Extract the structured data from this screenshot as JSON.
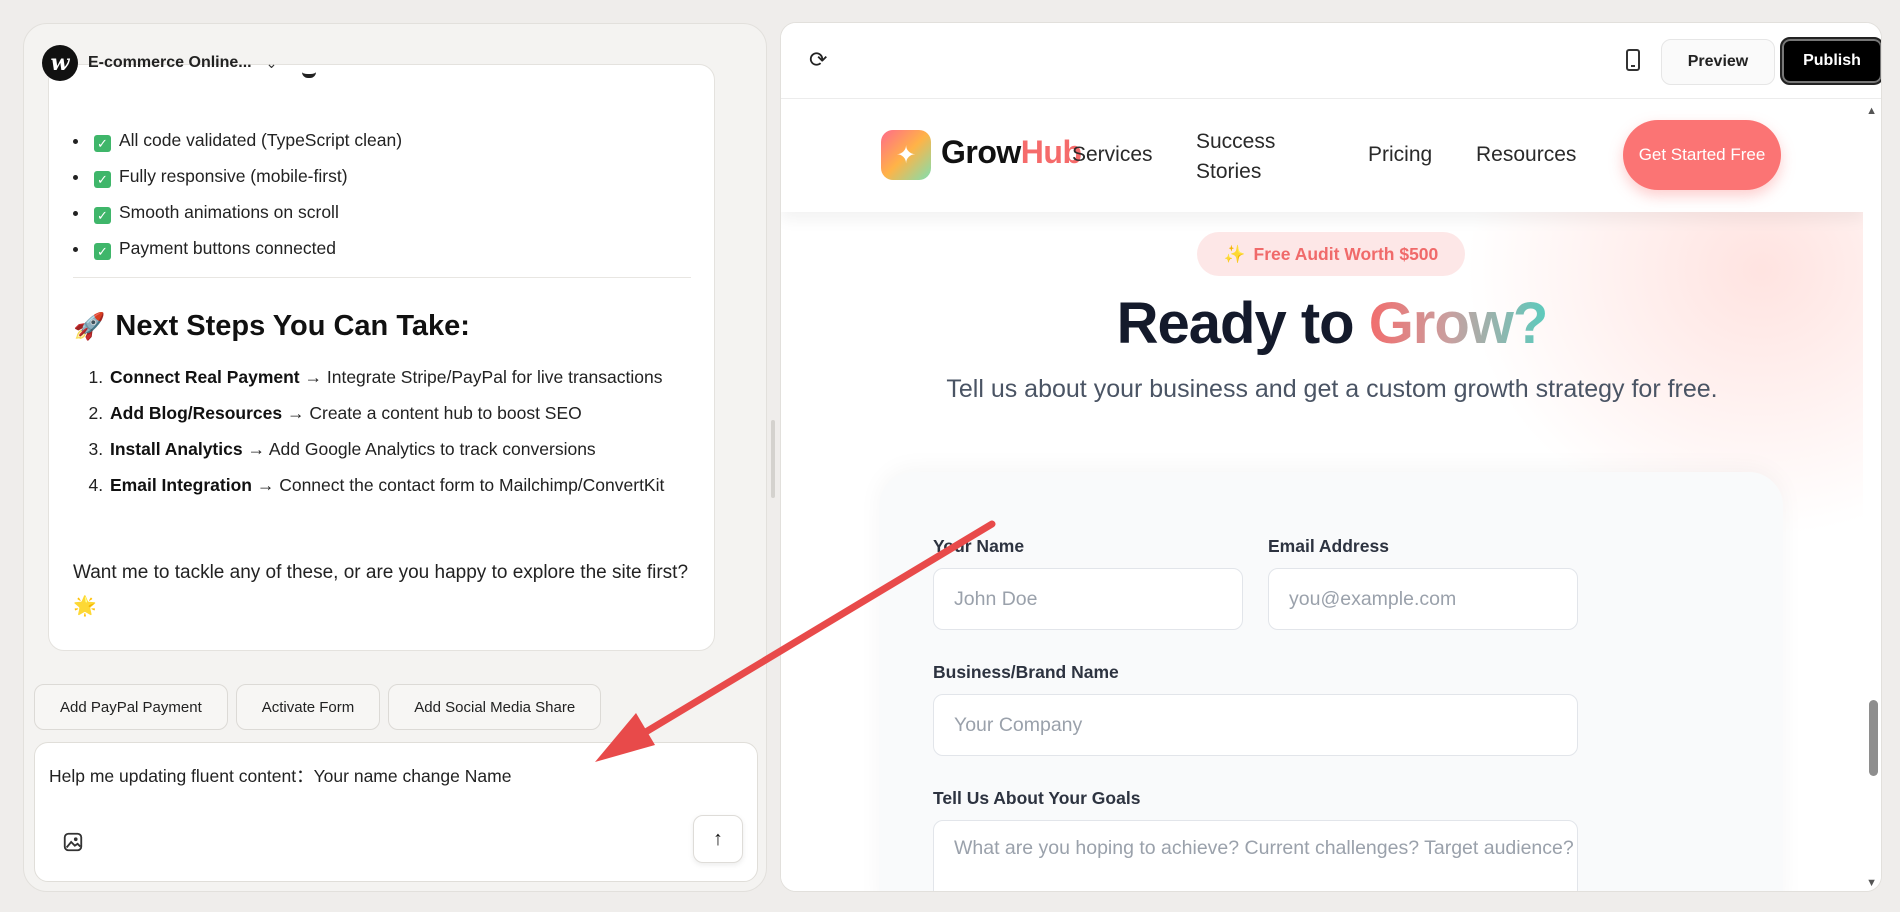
{
  "project": {
    "name": "E-commerce Online..."
  },
  "chat": {
    "checks": [
      "All code validated (TypeScript clean)",
      "Fully responsive (mobile-first)",
      "Smooth animations on scroll",
      "Payment buttons connected"
    ],
    "next_title": "Next Steps You Can Take:",
    "steps": [
      {
        "bold": "Connect Real Payment",
        "rest": " → Integrate Stripe/PayPal for live transactions"
      },
      {
        "bold": "Add Blog/Resources",
        "rest": " → Create a content hub to boost SEO"
      },
      {
        "bold": "Install Analytics",
        "rest": " → Add Google Analytics to track conversions"
      },
      {
        "bold": "Email Integration",
        "rest": " → Connect the contact form to Mailchimp/ConvertKit"
      }
    ],
    "closing": "Want me to tackle any of these, or are you happy to explore the site first? 🌟"
  },
  "chips": [
    "Add PayPal Payment",
    "Activate Form",
    "Add Social Media Share"
  ],
  "input": {
    "value": "Help me updating fluent content：Your name change Name"
  },
  "toolbar": {
    "preview": "Preview",
    "publish": "Publish"
  },
  "site": {
    "brand_grow": "Grow",
    "brand_hub": "Hub",
    "nav": [
      "Services",
      "Success Stories",
      "Pricing",
      "Resources"
    ],
    "cta": "Get Started Free",
    "audit": "Free Audit Worth $500",
    "hero_prefix": "Ready to ",
    "hero_grow": "Grow?",
    "hero_sub": "Tell us about your business and get a custom growth strategy for free.",
    "form": {
      "name_label": "Your Name",
      "name_placeholder": "John Doe",
      "email_label": "Email Address",
      "email_placeholder": "you@example.com",
      "company_label": "Business/Brand Name",
      "company_placeholder": "Your Company",
      "goals_label": "Tell Us About Your Goals",
      "goals_placeholder": "What are you hoping to achieve? Current challenges? Target audience?"
    }
  },
  "colors": {
    "accent": "#fb7474",
    "check": "#3fb66a",
    "annotation": "#e84a4a"
  }
}
